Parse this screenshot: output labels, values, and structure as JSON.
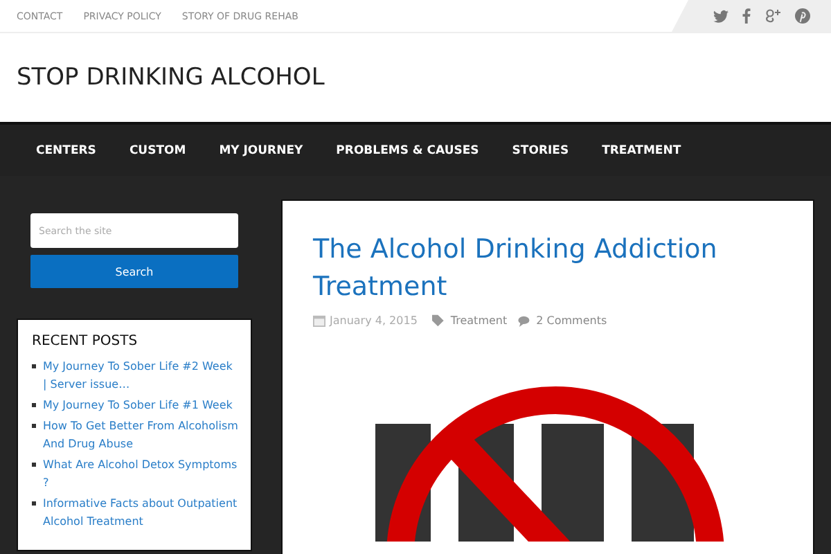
{
  "top_links": [
    "CONTACT",
    "PRIVACY POLICY",
    "STORY OF DRUG REHAB"
  ],
  "site_title": "STOP DRINKING ALCOHOL",
  "nav": [
    "CENTERS",
    "CUSTOM",
    "MY JOURNEY",
    "PROBLEMS & CAUSES",
    "STORIES",
    "TREATMENT"
  ],
  "search": {
    "placeholder": "Search the site",
    "button": "Search"
  },
  "recent_posts": {
    "heading": "RECENT POSTS",
    "items": [
      "My Journey To Sober Life #2 Week | Server issue…",
      "My Journey To Sober Life #1 Week",
      "How To Get Better From Alcoholism And Drug Abuse",
      "What Are Alcohol Detox Symptoms ?",
      "Informative Facts about Outpatient Alcohol Treatment"
    ]
  },
  "post": {
    "title": "The Alcohol Drinking Addiction Treatment",
    "date": "January 4, 2015",
    "category": "Treatment",
    "comments": "2 Comments"
  }
}
